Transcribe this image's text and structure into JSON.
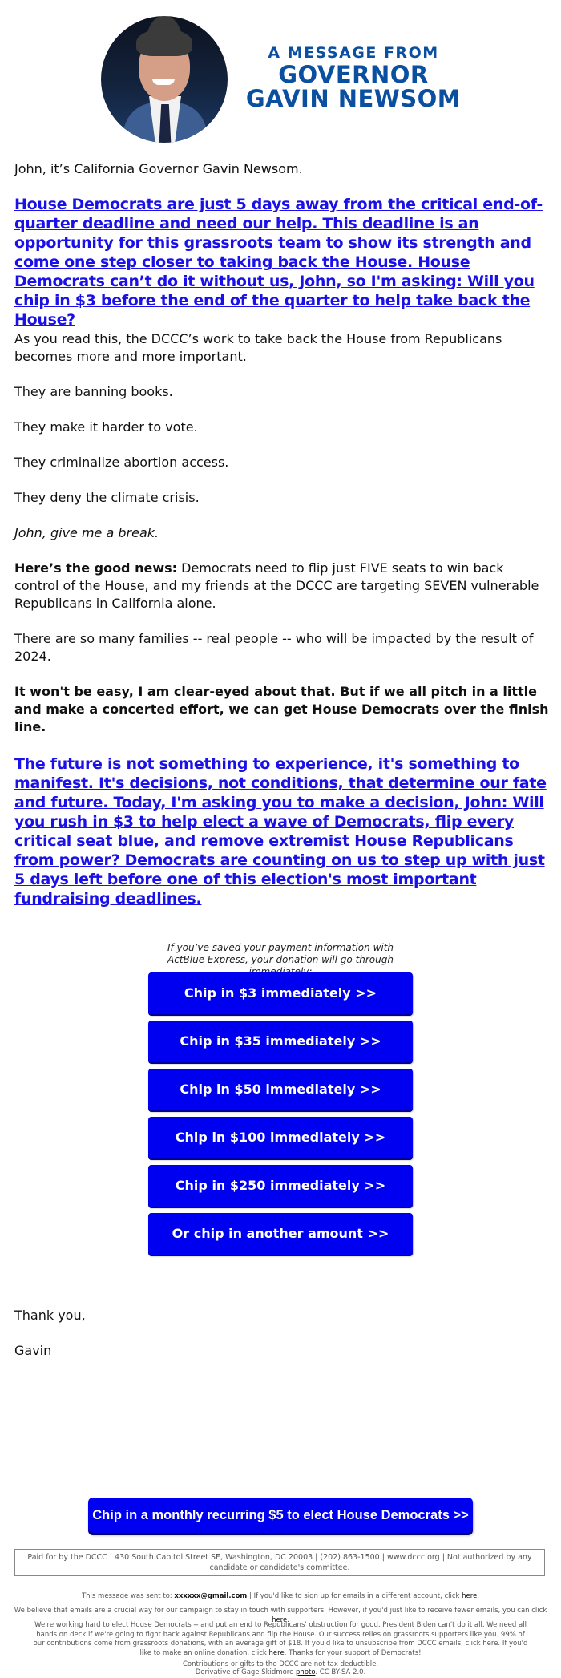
{
  "header": {
    "photo_alt": "Governor Gavin Newsom portrait",
    "kicker": "A MESSAGE FROM",
    "title_line1": "GOVERNOR",
    "title_line2": "GAVIN NEWSOM",
    "brand_color": "#0a4fa0"
  },
  "body": {
    "greeting": "John, it’s California Governor Gavin Newsom.",
    "lead_link": "House Democrats are just 5 days away from the critical end-of-quarter deadline and need our help. This deadline is an opportunity for this grassroots team to show its strength and come one step closer to taking back the House. House Democrats can’t do it without us, John, so I'm asking: Will you chip in $3 before the end of the quarter to help take back the House?",
    "p1": "As you read this, the DCCC’s work to take back the House from Republicans becomes more and more important.",
    "p2": "They are banning books.",
    "p3": "They make it harder to vote.",
    "p4": "They criminalize abortion access.",
    "p5": "They deny the climate crisis.",
    "p6": "John, give me a break.",
    "p7_bold": "Here’s the good news:",
    "p7_rest": " Democrats need to flip just FIVE seats to win back control of the House, and my friends at the DCCC are targeting SEVEN vulnerable Republicans in California alone.",
    "p8": "There are so many families -- real people -- who will be impacted by the result of 2024.",
    "p9": "It won't be easy, I am clear-eyed about that. But if we all pitch in a little and make a concerted effort, we can get House Democrats over the finish line.",
    "closing_link": "The future is not something to experience, it's something to manifest. It's decisions, not conditions, that determine our fate and future. Today, I'm asking you to make a decision, John: Will you rush in $3 to help elect a wave of Democrats, flip every critical seat blue, and remove extremist House Republicans from power? Democrats are counting on us to step up with just 5 days left before one of this election's most important fundraising deadlines.",
    "link_color": "#1a10e8"
  },
  "donation": {
    "note": "If you’ve saved your payment information with ActBlue Express, your donation will go through immediately:",
    "buttons": [
      {
        "label": "Chip in $3 immediately >>"
      },
      {
        "label": "Chip in $35 immediately >>"
      },
      {
        "label": "Chip in $50 immediately >>"
      },
      {
        "label": "Chip in $100 immediately >>"
      },
      {
        "label": "Chip in $250 immediately >>"
      },
      {
        "label": "Or chip in another amount >>"
      }
    ],
    "button_color": "#0000f0"
  },
  "signoff": {
    "thanks": "Thank you,",
    "name": "Gavin"
  },
  "monthly_button": "Chip in a monthly recurring $5 to elect House Democrats >>",
  "footer": {
    "disclaimer": "Paid for by the DCCC | 430 South Capitol Street SE, Washington, DC 20003 | (202) 863-1500 | www.dccc.org | Not authorized by any candidate or candidate's committee.",
    "sent_to_prefix": "This message was sent to: ",
    "sent_to_email": "xxxxxx@gmail.com",
    "sent_to_suffix": " | If you'd like to sign up for emails in a different account, click ",
    "here": "here",
    "period": ".",
    "fewer_emails": "We believe that emails are a crucial way for our campaign to stay in touch with supporters. However, if you'd just like to receive fewer emails, you can click ",
    "working_hard": "We're working hard to elect House Democrats -- and put an end to Republicans' obstruction for good. President Biden can't do it all. We need all hands on deck if we're going to fight back against Republicans and flip the House. Our success relies on grassroots supporters like you. 99% of our contributions come from grassroots donations, with an average gift of $18. If you'd like to unsubscribe from DCCC emails, click here. If you'd like to make an online donation, click ",
    "thanks_support": ". Thanks for your support of Democrats!",
    "tax": "Contributions or gifts to the DCCC are not tax deductible.",
    "credit_prefix": "Derivative of Gage Skidmore ",
    "credit_link": "photo",
    "credit_suffix": ". CC BY-SA 2.0."
  }
}
